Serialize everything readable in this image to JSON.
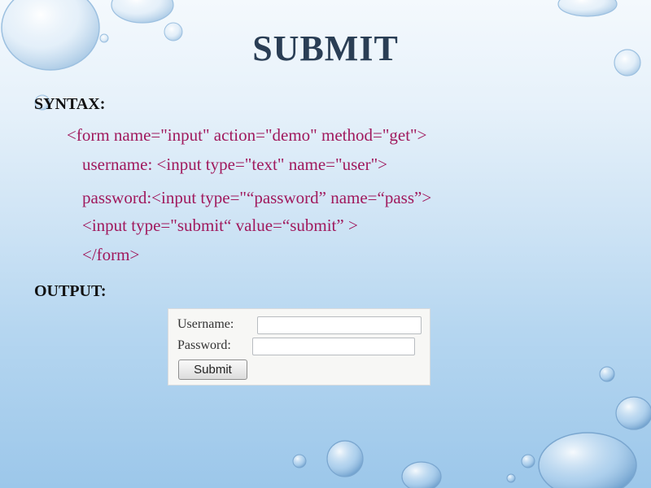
{
  "slide": {
    "title": "SUBMIT",
    "syntax_label": "SYNTAX:",
    "code_lines": [
      "<form name=\"input\" action=\"demo\" method=\"get\">",
      "username: <input type=\"text\" name=\"user\">",
      "password:<input type=\"“password” name=“pass”>",
      "<input type=\"submit“ value=“submit” >",
      "</form>"
    ],
    "output_label": "OUTPUT:"
  },
  "form_preview": {
    "username_label": "Username:",
    "password_label": "Password:",
    "username_value": "",
    "password_value": "",
    "submit_label": "Submit"
  },
  "colors": {
    "title": "#2a3e55",
    "code": "#a0195d",
    "label": "#111111"
  },
  "decoration": "water-droplets-background"
}
